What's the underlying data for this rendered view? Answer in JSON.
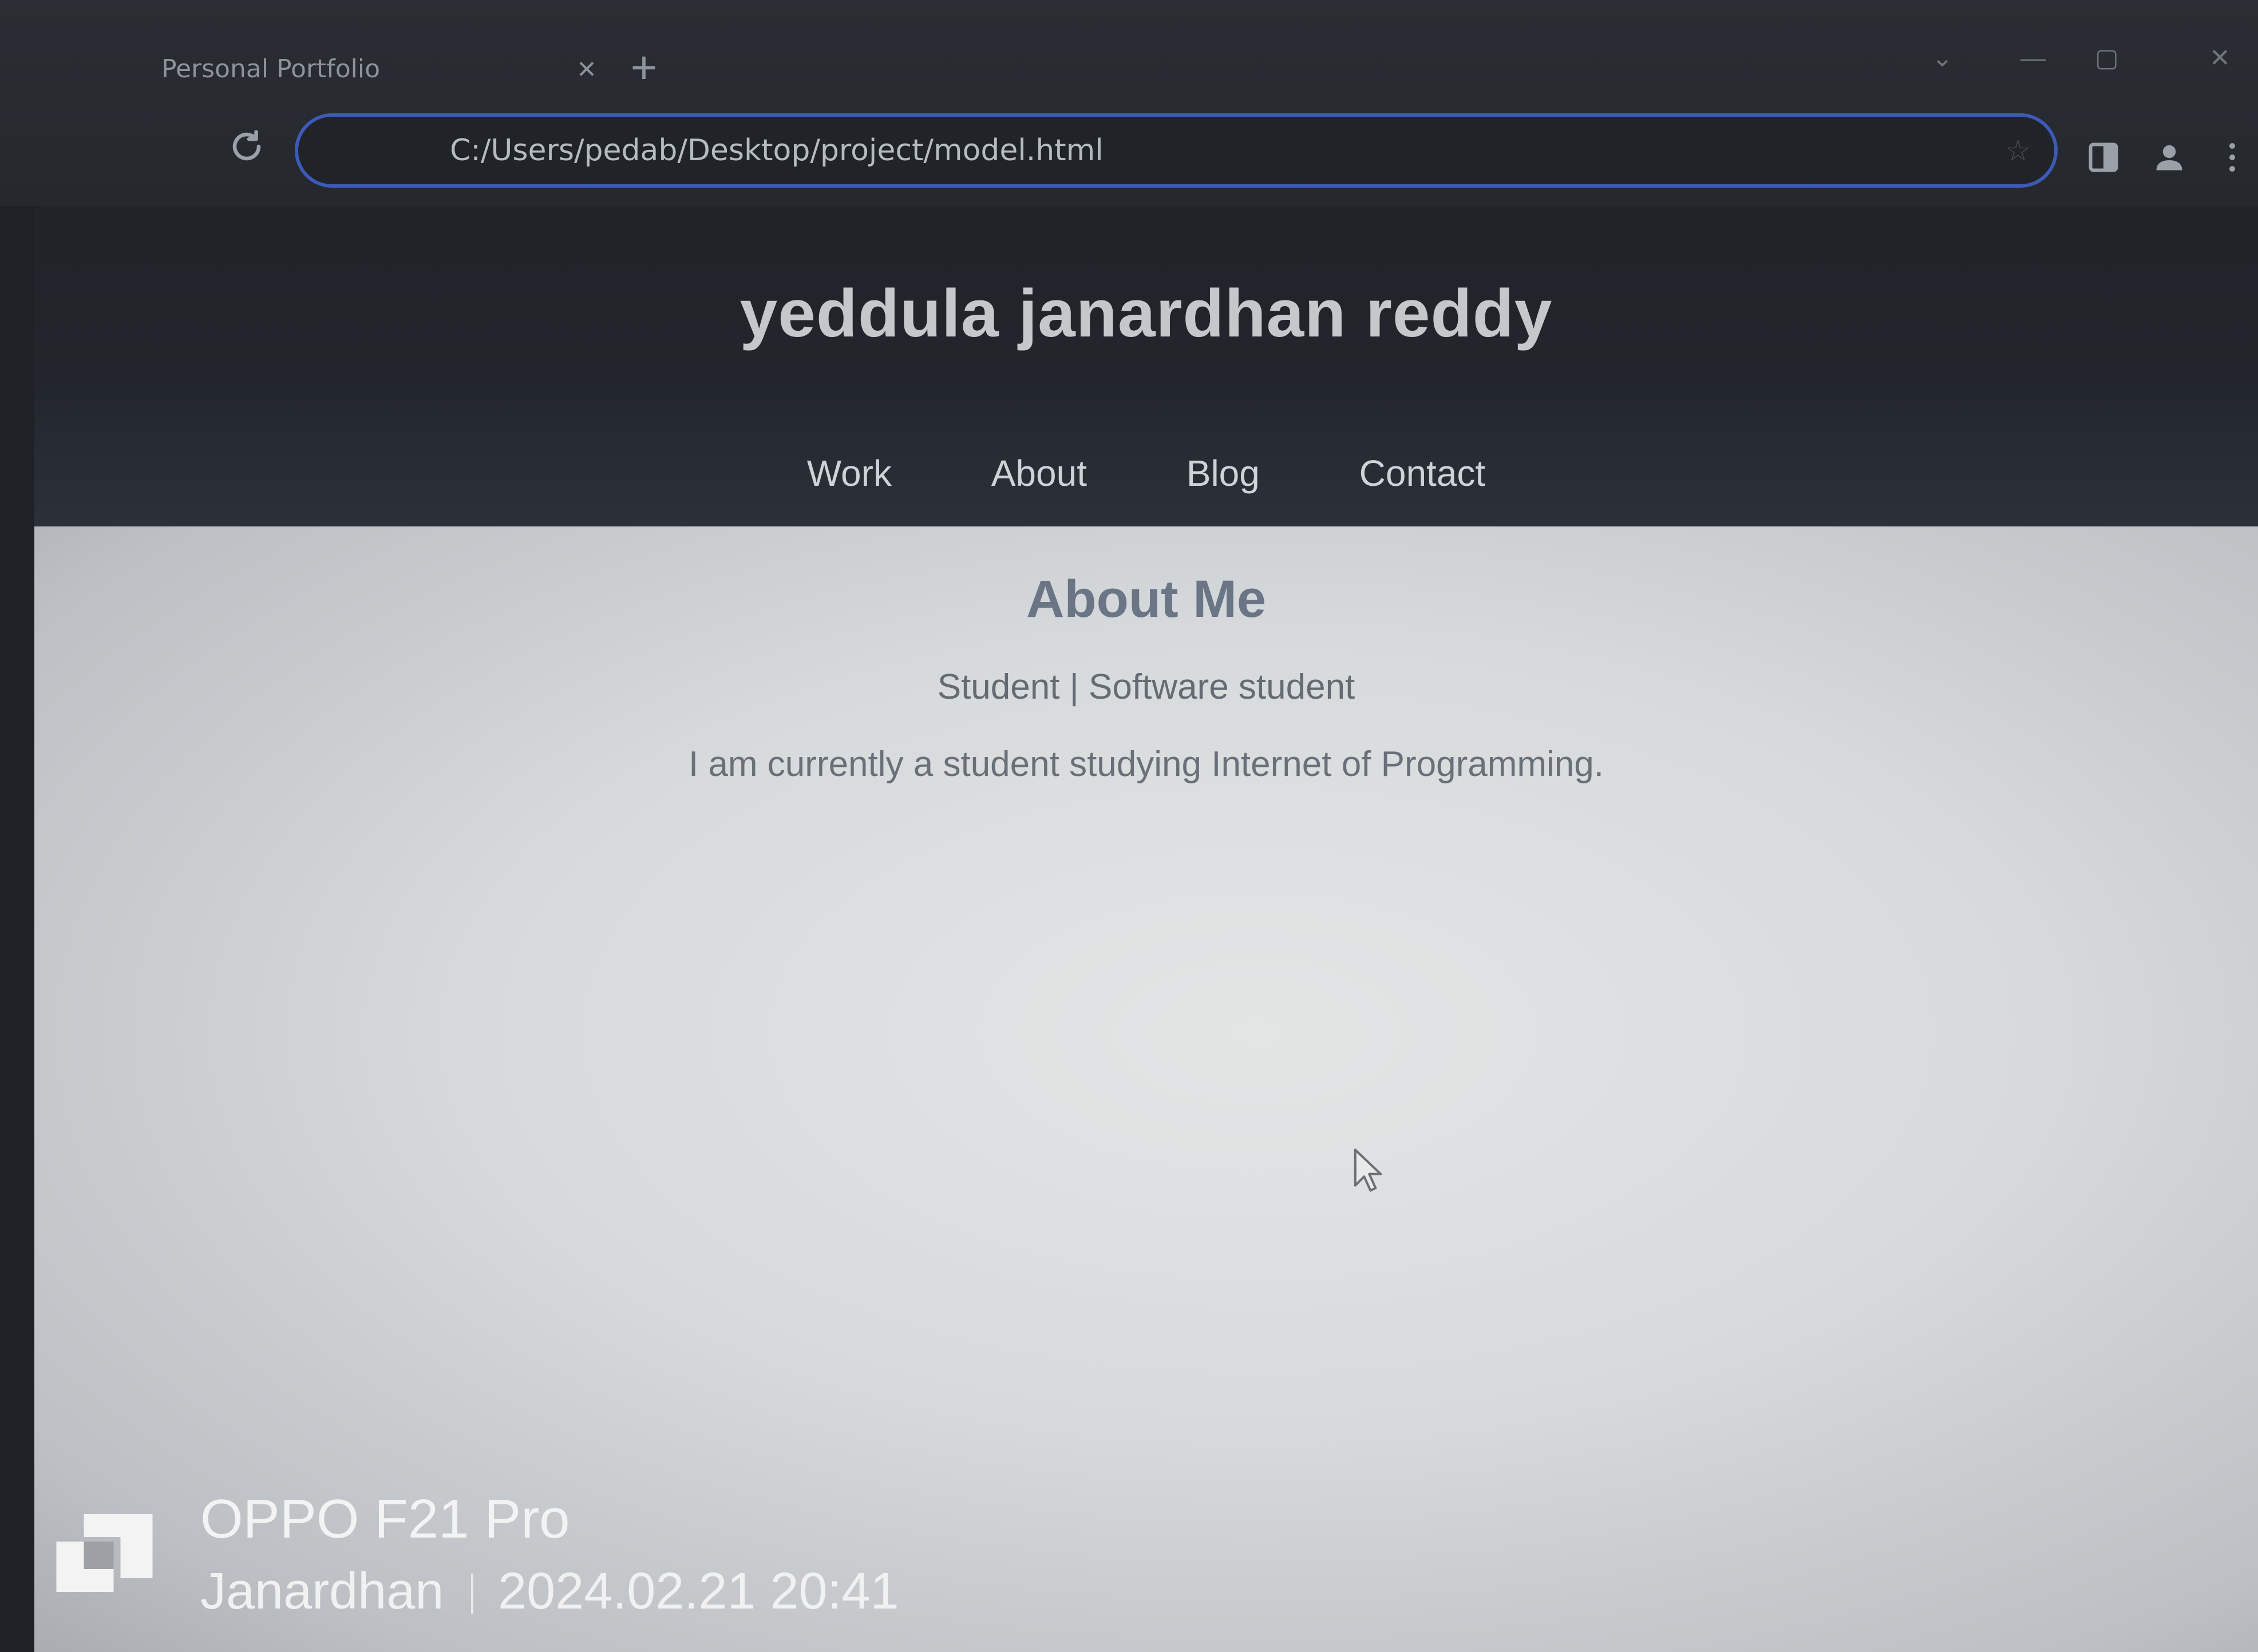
{
  "browser": {
    "tab_title": "Personal Portfolio",
    "tab_close_icon": "close-icon",
    "new_tab_icon": "plus-icon",
    "address": "C:/Users/pedab/Desktop/project/model.html"
  },
  "header": {
    "site_title": "yeddula janardhan reddy",
    "nav": [
      {
        "label": "Work"
      },
      {
        "label": "About"
      },
      {
        "label": "Blog"
      },
      {
        "label": "Contact"
      }
    ]
  },
  "about": {
    "heading": "About Me",
    "subtitle": "Student | Software student",
    "text": "I am currently a student studying Internet of Programming."
  },
  "watermark": {
    "device": "OPPO F21 Pro",
    "user": "Janardhan",
    "datetime": "2024.02.21 20:41"
  },
  "colors": {
    "address_border": "#3d5ab8",
    "heading": "#6a7586",
    "header_bg": "#22262c"
  }
}
